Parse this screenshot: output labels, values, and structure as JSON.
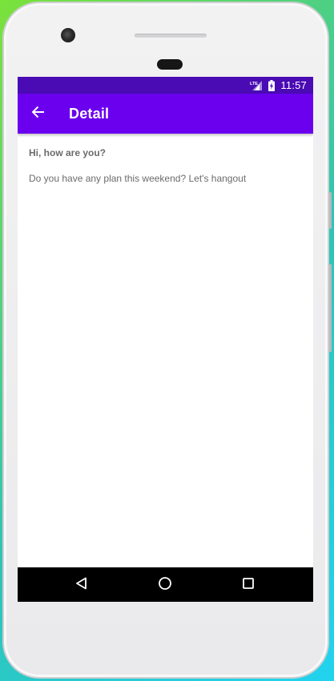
{
  "status_bar": {
    "network_label": "LTE",
    "time": "11:57",
    "icons": [
      "lte-signal-icon",
      "battery-charging-icon"
    ]
  },
  "app_bar": {
    "title": "Detail",
    "back_icon": "arrow-left-icon"
  },
  "message": {
    "title": "Hi, how are you?",
    "body": "Do you have any plan this weekend? Let's hangout"
  },
  "nav_bar": {
    "items": [
      "back-triangle-icon",
      "home-circle-icon",
      "recents-square-icon"
    ]
  },
  "colors": {
    "status_bar": "#4a0ab4",
    "app_bar": "#6a00ee",
    "text": "#6b6b6b",
    "nav_bar": "#000000"
  }
}
